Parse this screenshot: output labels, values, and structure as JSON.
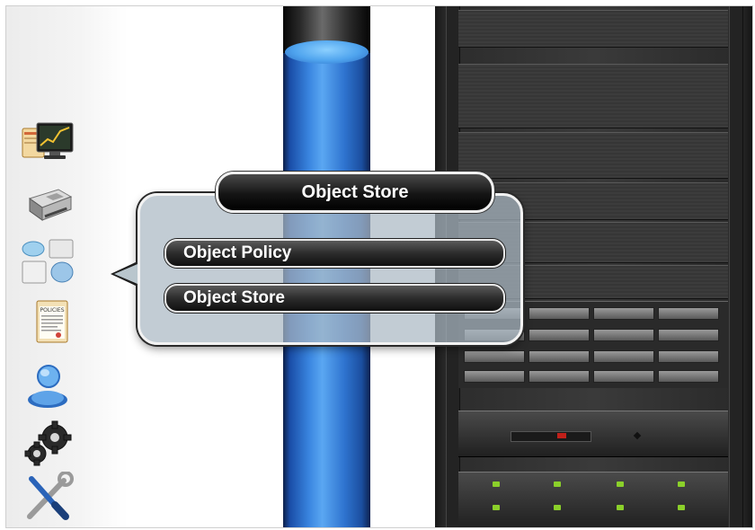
{
  "popup": {
    "title": "Object Store",
    "items": [
      {
        "label": "Object Policy"
      },
      {
        "label": "Object Store"
      }
    ]
  },
  "sidebar": {
    "icons": [
      "monitoring-icon",
      "storage-device-icon",
      "object-store-icon",
      "policies-icon",
      "user-icon",
      "settings-gears-icon",
      "tools-icon"
    ],
    "policies_icon_text": "POLICIES"
  },
  "colors": {
    "cylinder_blue": "#3a86e0",
    "popup_panel": "#aab9c3",
    "menu_dark": "#1a1a1a",
    "rack_dark": "#2c2c2c",
    "led_green": "#8bd02a",
    "led_red": "#c0201a"
  }
}
